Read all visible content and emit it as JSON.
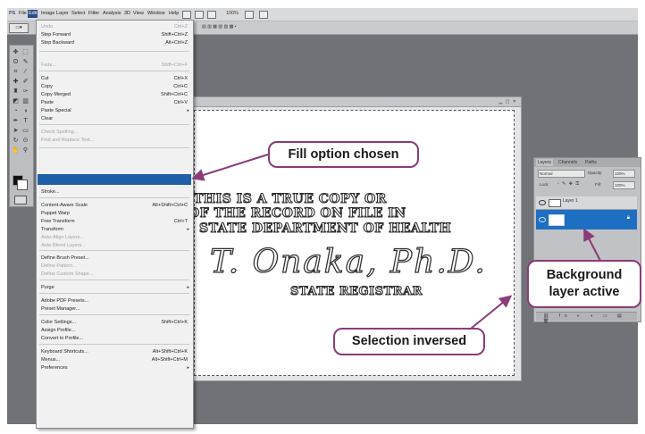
{
  "app": {
    "logo": "PS",
    "menubar": [
      "File",
      "Edit",
      "Image",
      "Layer",
      "Select",
      "Filter",
      "Analysis",
      "3D",
      "View",
      "Window",
      "Help"
    ],
    "menubar_selected": "Edit",
    "toolbar_labels": [
      "100%"
    ]
  },
  "edit_menu": {
    "items": [
      {
        "label": "Undo",
        "shortcut": "Ctrl+Z",
        "disabled": true
      },
      {
        "label": "Step Forward",
        "shortcut": "Shift+Ctrl+Z",
        "disabled": false
      },
      {
        "label": "Step Backward",
        "shortcut": "Alt+Ctrl+Z",
        "disabled": false
      },
      {
        "label": "Fade...",
        "shortcut": "Shift+Ctrl+F",
        "disabled": true
      },
      {
        "label": "Cut",
        "shortcut": "Ctrl+X",
        "disabled": false
      },
      {
        "label": "Copy",
        "shortcut": "Ctrl+C",
        "disabled": false
      },
      {
        "label": "Copy Merged",
        "shortcut": "Shift+Ctrl+C",
        "disabled": false
      },
      {
        "label": "Paste",
        "shortcut": "Ctrl+V",
        "disabled": false
      },
      {
        "label": "Paste Special",
        "shortcut": "",
        "disabled": false
      },
      {
        "label": "Clear",
        "shortcut": "",
        "disabled": false
      },
      {
        "label": "Check Spelling...",
        "shortcut": "",
        "disabled": true
      },
      {
        "label": "Find and Replace Text...",
        "shortcut": "",
        "disabled": true
      },
      {
        "label": "",
        "shortcut": "",
        "disabled": false
      },
      {
        "label": "Stroke...",
        "shortcut": "",
        "disabled": false
      },
      {
        "label": "Content-Aware Scale",
        "shortcut": "Alt+Shift+Ctrl+C",
        "disabled": false
      },
      {
        "label": "Puppet Warp",
        "shortcut": "",
        "disabled": false
      },
      {
        "label": "Free Transform",
        "shortcut": "Ctrl+T",
        "disabled": false
      },
      {
        "label": "Transform",
        "shortcut": "",
        "disabled": false
      },
      {
        "label": "Auto-Align Layers...",
        "shortcut": "",
        "disabled": true
      },
      {
        "label": "Auto-Blend Layers...",
        "shortcut": "",
        "disabled": true
      },
      {
        "label": "Define Brush Preset...",
        "shortcut": "",
        "disabled": false
      },
      {
        "label": "Define Pattern...",
        "shortcut": "",
        "disabled": true
      },
      {
        "label": "Define Custom Shape...",
        "shortcut": "",
        "disabled": true
      },
      {
        "label": "Purge",
        "shortcut": "",
        "disabled": false
      },
      {
        "label": "Adobe PDF Presets...",
        "shortcut": "",
        "disabled": false
      },
      {
        "label": "Preset Manager...",
        "shortcut": "",
        "disabled": false
      },
      {
        "label": "Color Settings...",
        "shortcut": "Shift+Ctrl+K",
        "disabled": false
      },
      {
        "label": "Assign Profile...",
        "shortcut": "",
        "disabled": false
      },
      {
        "label": "Convert to Profile...",
        "shortcut": "",
        "disabled": false
      },
      {
        "label": "Keyboard Shortcuts...",
        "shortcut": "Alt+Shift+Ctrl+K",
        "disabled": false
      },
      {
        "label": "Menus...",
        "shortcut": "Alt+Shift+Ctrl+M",
        "disabled": false
      },
      {
        "label": "Preferences",
        "shortcut": "",
        "disabled": false
      }
    ]
  },
  "document": {
    "lines": [
      "THIS IS A TRUE COPY OR",
      "OF THE RECORD ON FILE IN",
      "STATE DEPARTMENT OF HEALTH"
    ],
    "signature": "T. Onaka, Ph.D.",
    "registrar": "STATE REGISTRAR"
  },
  "layers_panel": {
    "tabs": [
      "Layers",
      "Channels",
      "Paths"
    ],
    "blend_mode": "Normal",
    "opacity_label": "Opacity:",
    "opacity_value": "100%",
    "lock_label": "Lock:",
    "fill_label": "Fill:",
    "fill_value": "100%",
    "layers": [
      {
        "name": "Layer 1",
        "active": false
      },
      {
        "name": "Background",
        "active": true
      }
    ]
  },
  "callouts": {
    "fill": "Fill option chosen",
    "selection": "Selection inversed",
    "background_line1": "Background",
    "background_line2": "layer active"
  },
  "colors": {
    "callout_border": "#8a3c78",
    "highlight": "#1e5fa8",
    "active_layer": "#1e6fc2"
  }
}
